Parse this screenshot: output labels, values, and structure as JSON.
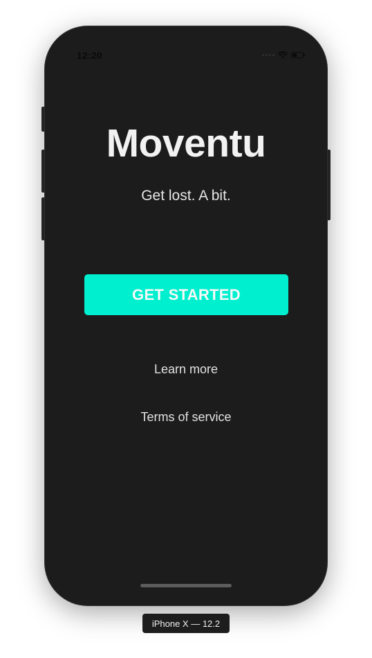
{
  "status_bar": {
    "time": "12:20",
    "icons": [
      "signal-icon",
      "wifi-icon",
      "battery-icon"
    ]
  },
  "app": {
    "title": "Moventu",
    "tagline": "Get lost. A bit.",
    "get_started_label": "GET STARTED",
    "learn_more_label": "Learn more",
    "terms_label": "Terms of service"
  },
  "simulator": {
    "device_label": "iPhone X — 12.2"
  },
  "colors": {
    "background": "#1c1c1c",
    "accent": "#00f0cf",
    "text_primary": "#f2f2f2"
  }
}
